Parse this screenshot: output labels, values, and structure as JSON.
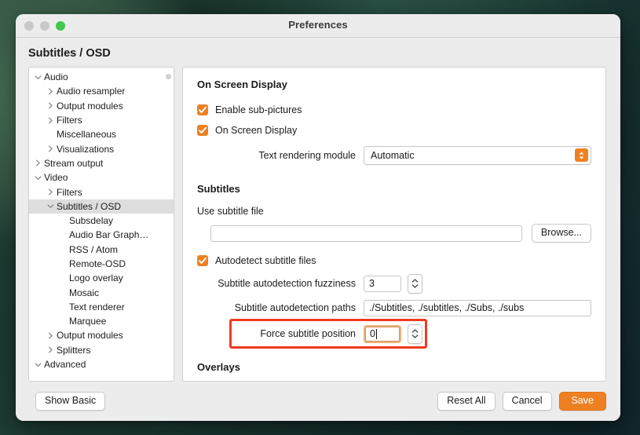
{
  "window": {
    "title": "Preferences",
    "page_title": "Subtitles / OSD",
    "traffic_lights": [
      "close-button",
      "minimize-button",
      "zoom-button"
    ],
    "colors": {
      "accent": "#ef8022",
      "highlight_box": "#f03b20",
      "zoom_light": "#41c74e",
      "inactive_light": "#c8c8c8",
      "chrome": "#ececec"
    }
  },
  "sidebar": {
    "items": [
      {
        "label": "Audio",
        "level": 0,
        "twisty": "chevron-down",
        "selected": false
      },
      {
        "label": "Audio resampler",
        "level": 1,
        "twisty": "chevron-right",
        "selected": false
      },
      {
        "label": "Output modules",
        "level": 1,
        "twisty": "chevron-right",
        "selected": false
      },
      {
        "label": "Filters",
        "level": 1,
        "twisty": "chevron-right",
        "selected": false
      },
      {
        "label": "Miscellaneous",
        "level": 1,
        "twisty": "none",
        "selected": false
      },
      {
        "label": "Visualizations",
        "level": 1,
        "twisty": "chevron-right",
        "selected": false
      },
      {
        "label": "Stream output",
        "level": 0,
        "twisty": "chevron-right",
        "selected": false
      },
      {
        "label": "Video",
        "level": 0,
        "twisty": "chevron-down",
        "selected": false
      },
      {
        "label": "Filters",
        "level": 1,
        "twisty": "chevron-right",
        "selected": false
      },
      {
        "label": "Subtitles / OSD",
        "level": 1,
        "twisty": "chevron-down",
        "selected": true
      },
      {
        "label": "Subsdelay",
        "level": 2,
        "twisty": "none",
        "selected": false
      },
      {
        "label": "Audio Bar Graph…",
        "level": 2,
        "twisty": "none",
        "selected": false
      },
      {
        "label": "RSS / Atom",
        "level": 2,
        "twisty": "none",
        "selected": false
      },
      {
        "label": "Remote-OSD",
        "level": 2,
        "twisty": "none",
        "selected": false
      },
      {
        "label": "Logo overlay",
        "level": 2,
        "twisty": "none",
        "selected": false
      },
      {
        "label": "Mosaic",
        "level": 2,
        "twisty": "none",
        "selected": false
      },
      {
        "label": "Text renderer",
        "level": 2,
        "twisty": "none",
        "selected": false
      },
      {
        "label": "Marquee",
        "level": 2,
        "twisty": "none",
        "selected": false
      },
      {
        "label": "Output modules",
        "level": 1,
        "twisty": "chevron-right",
        "selected": false
      },
      {
        "label": "Splitters",
        "level": 1,
        "twisty": "chevron-right",
        "selected": false
      },
      {
        "label": "Advanced",
        "level": 0,
        "twisty": "chevron-down",
        "selected": false
      }
    ]
  },
  "main": {
    "osd_section_title": "On Screen Display",
    "enable_subpictures": {
      "label": "Enable sub-pictures",
      "checked": true
    },
    "on_screen_display": {
      "label": "On Screen Display",
      "checked": true
    },
    "text_rendering_module": {
      "label": "Text rendering module",
      "value": "Automatic"
    },
    "subtitles_section_title": "Subtitles",
    "use_subtitle_file": {
      "label": "Use subtitle file",
      "value": "",
      "browse_label": "Browse..."
    },
    "autodetect_subtitle_files": {
      "label": "Autodetect subtitle files",
      "checked": true
    },
    "autodetection_fuzziness": {
      "label": "Subtitle autodetection fuzziness",
      "value": "3"
    },
    "autodetection_paths": {
      "label": "Subtitle autodetection paths",
      "value": "./Subtitles, ./subtitles, ./Subs, ./subs"
    },
    "force_subtitle_position": {
      "label": "Force subtitle position",
      "value": "0",
      "focused": true,
      "highlighted": true
    },
    "overlays_section_title": "Overlays"
  },
  "footer": {
    "show_basic": "Show Basic",
    "reset_all": "Reset All",
    "cancel": "Cancel",
    "save": "Save"
  }
}
